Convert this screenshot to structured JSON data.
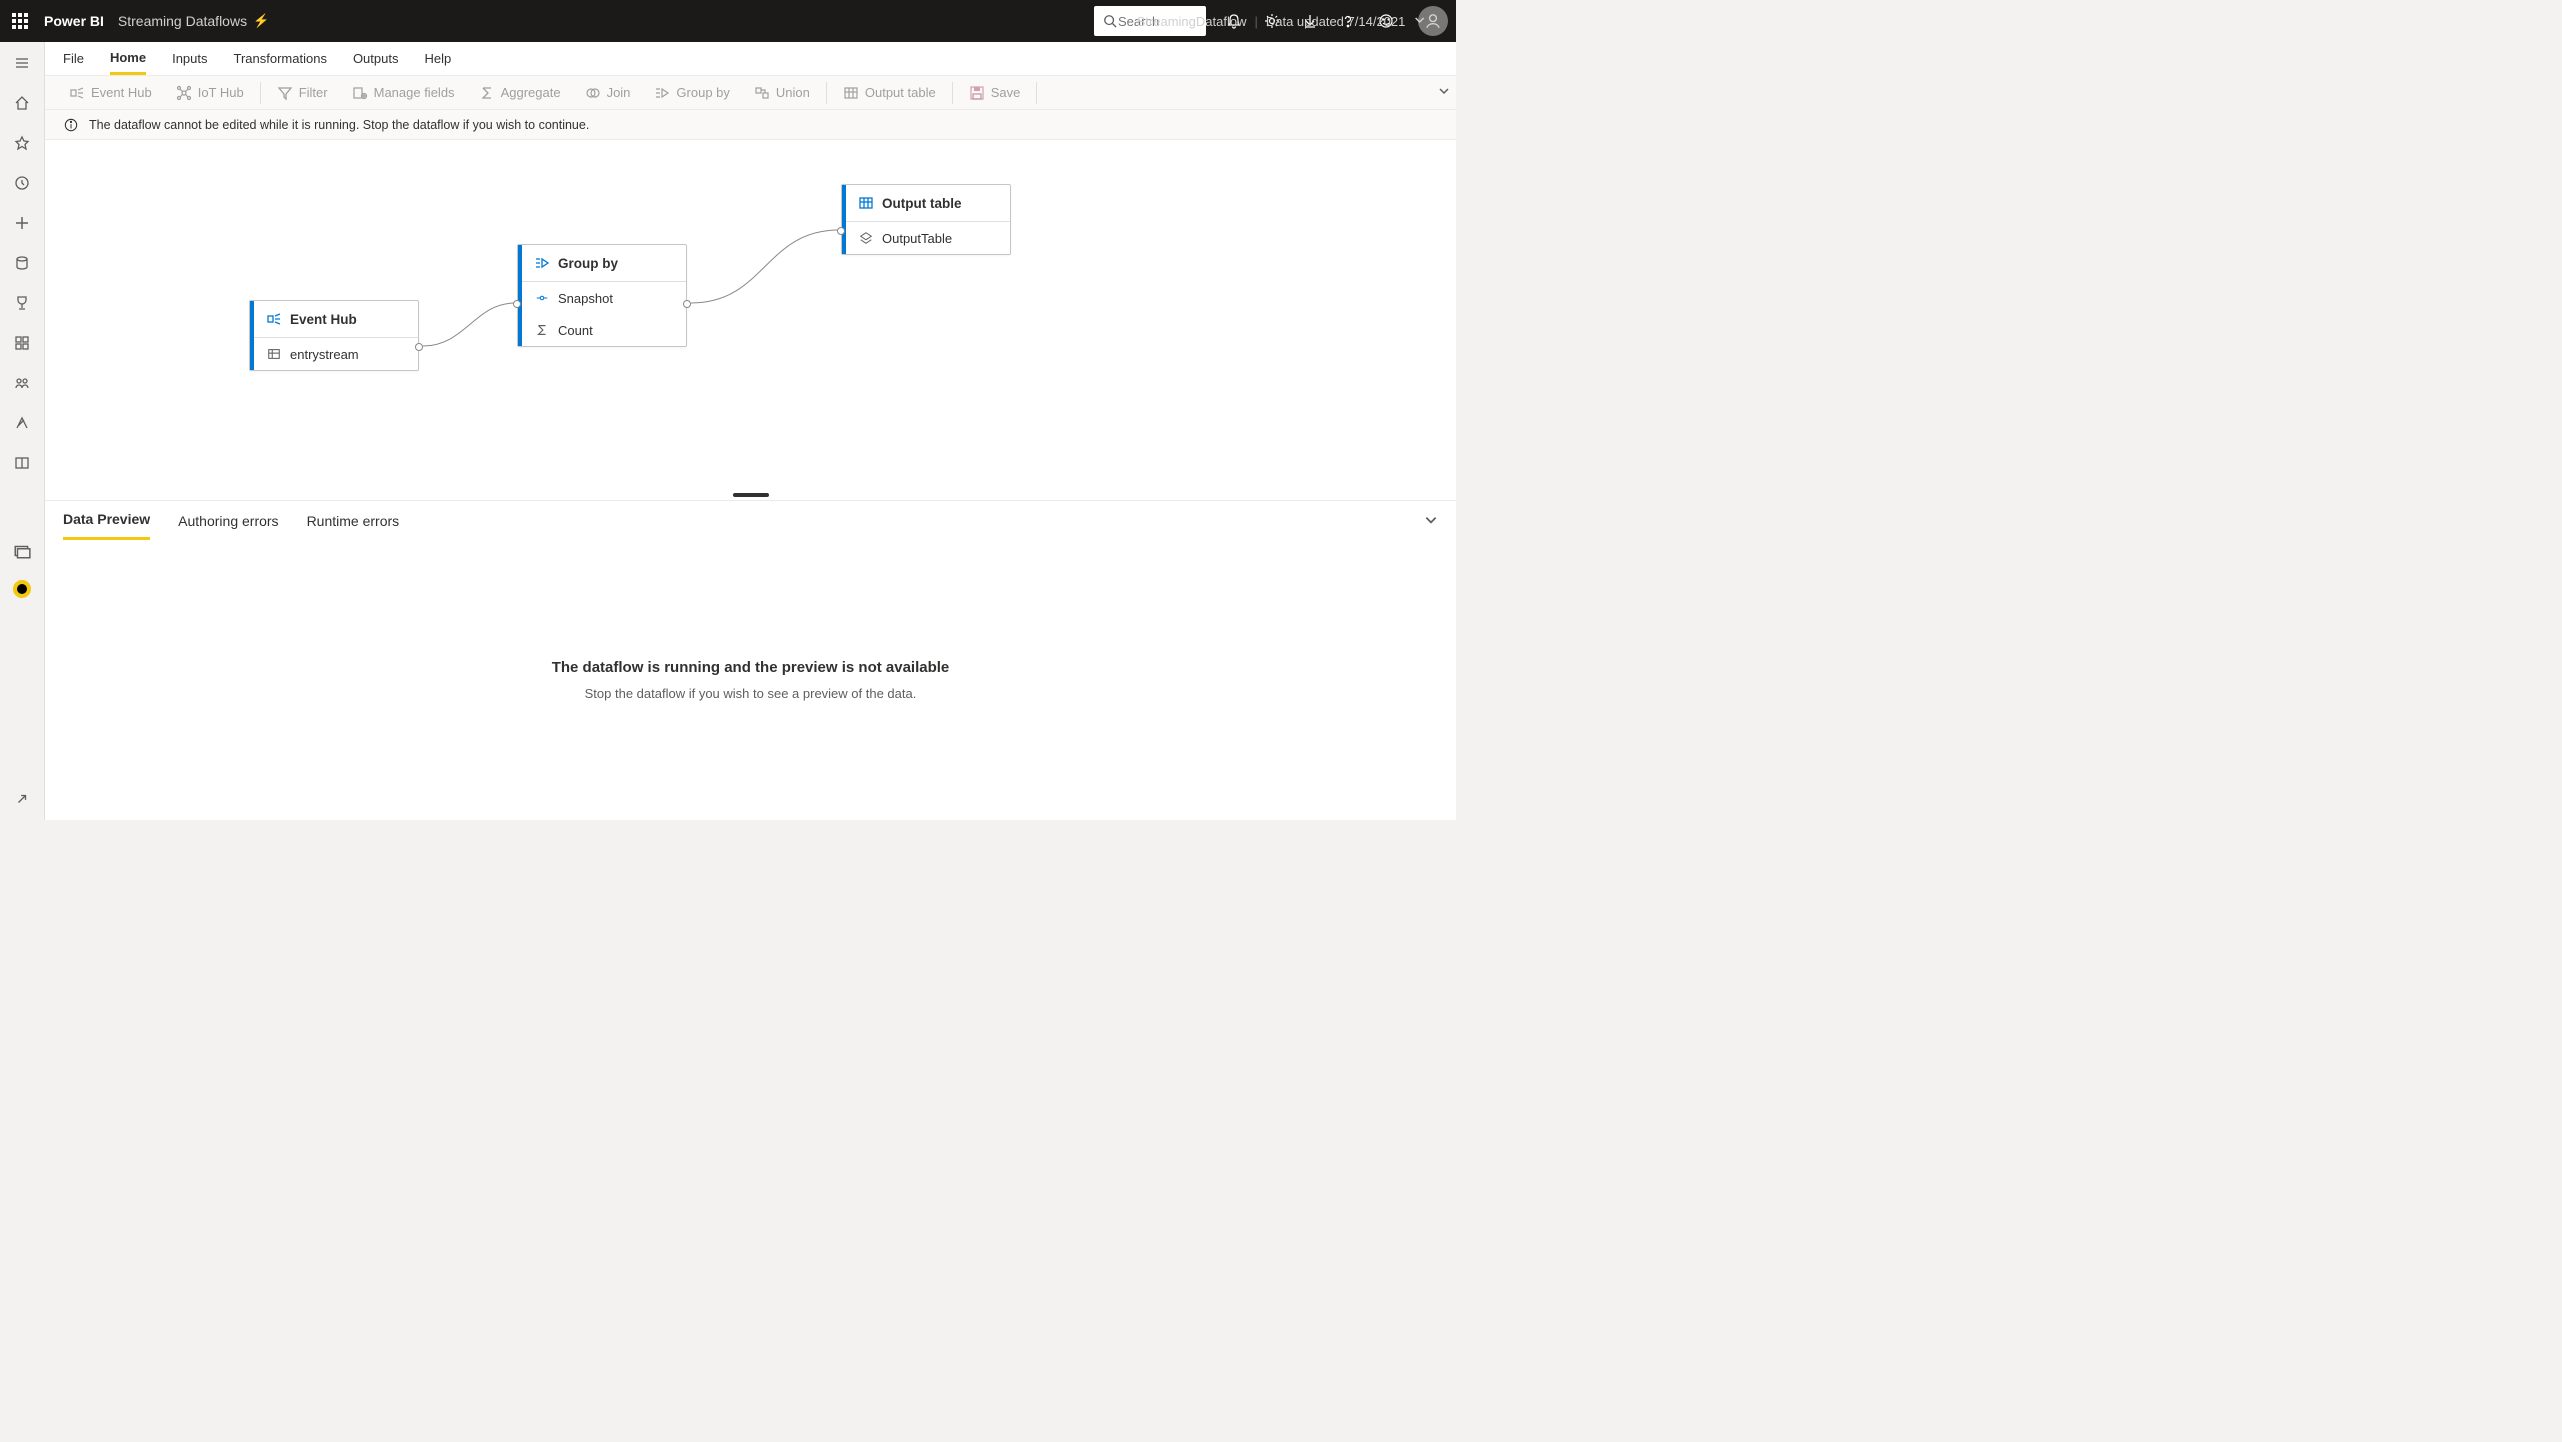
{
  "topbar": {
    "product": "Power BI",
    "title": "Streaming Dataflows",
    "center_name": "StreamingDataflow",
    "center_status": "Data updated 7/14/2021",
    "search_placeholder": "Search"
  },
  "menubar": {
    "items": [
      "File",
      "Home",
      "Inputs",
      "Transformations",
      "Outputs",
      "Help"
    ],
    "active": "Home"
  },
  "ribbon": {
    "event_hub": "Event Hub",
    "iot_hub": "IoT Hub",
    "filter": "Filter",
    "manage_fields": "Manage fields",
    "aggregate": "Aggregate",
    "join": "Join",
    "group_by": "Group by",
    "union": "Union",
    "output_table": "Output table",
    "save": "Save"
  },
  "warning": "The dataflow cannot be edited while it is running. Stop the dataflow if you wish to continue.",
  "nodes": {
    "event_hub": {
      "title": "Event Hub",
      "row1": "entrystream"
    },
    "group_by": {
      "title": "Group by",
      "row1": "Snapshot",
      "row2": "Count"
    },
    "output_table": {
      "title": "Output table",
      "row1": "OutputTable"
    }
  },
  "bottom": {
    "tabs": [
      "Data Preview",
      "Authoring errors",
      "Runtime errors"
    ],
    "active": "Data Preview",
    "headline": "The dataflow is running and the preview is not available",
    "sub": "Stop the dataflow if you wish to see a preview of the data."
  }
}
